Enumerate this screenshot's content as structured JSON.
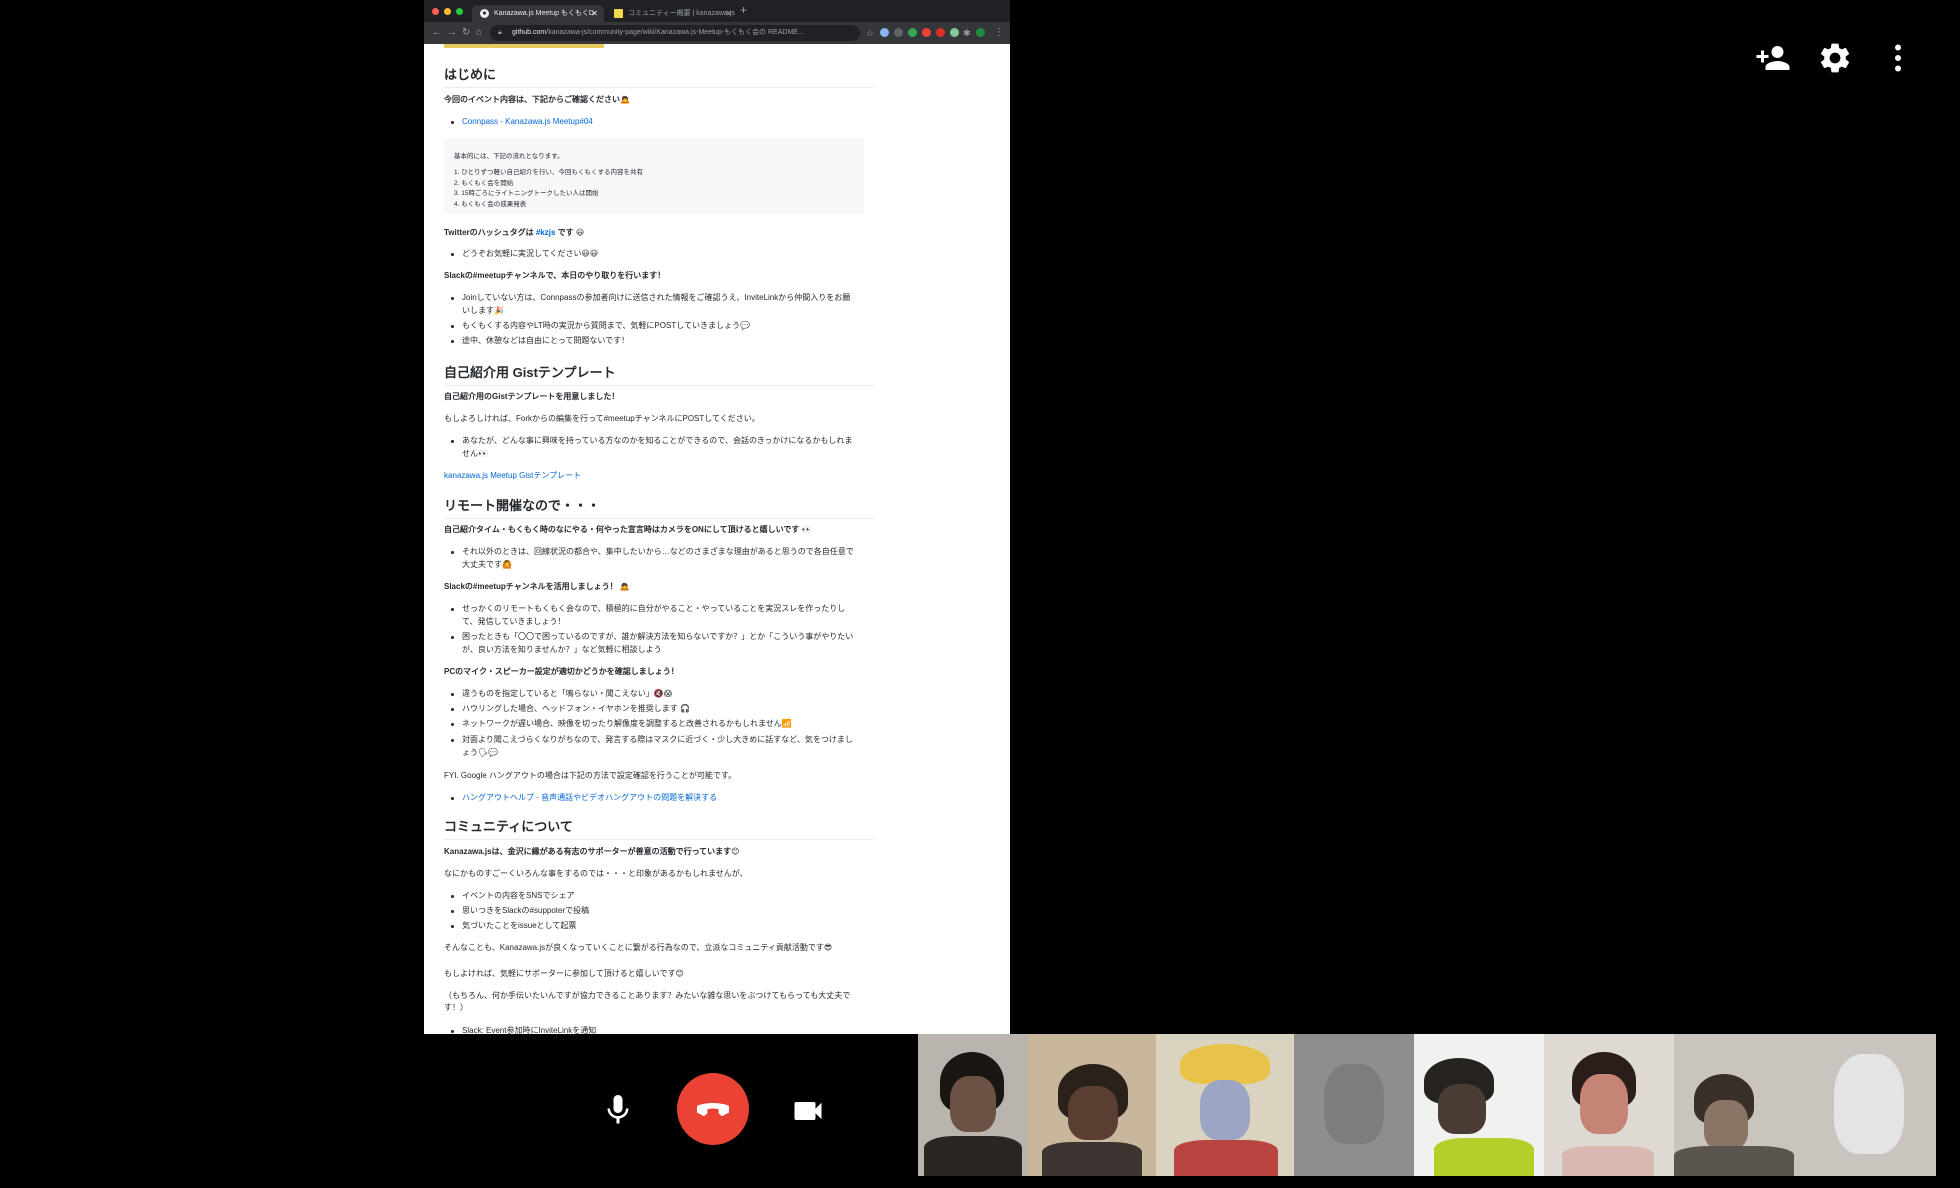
{
  "browser": {
    "tabs": [
      {
        "label": "Kanazawa.js Meetup もくもくD",
        "active": true
      },
      {
        "label": "コミュニティー概要 | kanazawa.js",
        "active": false
      }
    ],
    "url_host": "github.com",
    "url_path": "/kanazawa-js/community-page/wiki/Kanazawa.js-Meetup-もくもく会の README..."
  },
  "doc": {
    "h_intro": "はじめに",
    "intro_text": "今回のイベント内容は、下記からご確認ください🙇",
    "connpass_link": "Connpass - Kanazawa.js Meetup#04",
    "flow_title": "基本的には、下記の流れとなります。",
    "flow_steps": [
      "1. ひとりずつ軽い自己紹介を行い、今回もくもくする内容を共有",
      "2. もくもく会を開始",
      "3. 15時ごろにライトニングトークしたい人は開始",
      "4. もくもく会の成果発表"
    ],
    "twitter_pre": "Twitterのハッシュタグは ",
    "twitter_tag": "#kzjs",
    "twitter_post": " です 😃",
    "twitter_item": "どうぞお気軽に実況してください😃😃",
    "slack_heading": "Slackの#meetupチャンネルで、本日のやり取りを行います！",
    "slack_items": [
      "Joinしていない方は、Connpassの参加者向けに送信された情報をご確認うえ、InviteLinkから仲間入りをお願いします🎉",
      "もくもくする内容やLT時の実況から質問まで、気軽にPOSTしていきましょう💬",
      "途中、休憩などは自由にとって問題ないです！"
    ],
    "h_gist": "自己紹介用 Gistテンプレート",
    "gist_heading": "自己紹介用のGistテンプレートを用意しました！",
    "gist_text": "もしよろしければ、Forkからの編集を行って#meetupチャンネルにPOSTしてください。",
    "gist_item": "あなたが、どんな事に興味を持っている方なのかを知ることができるので、会話のきっかけになるかもしれません👀",
    "gist_link": "kanazawa.js Meetup Gistテンプレート",
    "h_remote": "リモート開催なので・・・",
    "camera_heading": "自己紹介タイム・もくもく時のなにやる・何やった宣言時はカメラをONにして頂けると嬉しいです 👀",
    "camera_item": "それ以外のときは、回線状況の都合や、集中したいから…などのさまざまな理由があると思うので各自任意で大丈夫です🙆",
    "slack2_heading": "Slackの#meetupチャンネルを活用しましょう！ 🙇",
    "slack2_items": [
      "せっかくのリモートもくもく会なので、積極的に自分がやること・やっていることを実況スレを作ったりして、発信していきましょう！",
      "困ったときも「〇〇で困っているのですが、誰か解決方法を知らないですか？」とか「こういう事がやりたいが、良い方法を知りませんか？」など気軽に相談しよう"
    ],
    "pc_heading": "PCのマイク・スピーカー設定が適切かどうかを確認しましょう！",
    "pc_items": [
      "違うものを指定していると「鳴らない・聞こえない」🔇😱",
      "ハウリングした場合、ヘッドフォン・イヤホンを推奨します 🎧",
      "ネットワークが遅い場合、映像を切ったり解像度を調整すると改善されるかもしれません📶",
      "対面より聞こえづらくなりがちなので、発言する際はマスクに近づく・少し大きめに話すなど、気をつけましょう🗣💬"
    ],
    "fyi_text": "FYI. Google ハングアウトの場合は下記の方法で設定確認を行うことが可能です。",
    "fyi_link": "ハングアウトヘルプ - 音声通話やビデオハングアウトの問題を解決する",
    "h_community": "コミュニティについて",
    "community_heading": "Kanazawa.jsは、金沢に縁がある有志のサポーターが善意の活動で行っています😊",
    "community_text": "なにかものすごーくいろんな事をするのでは・・・と印象があるかもしれませんが、",
    "community_items": [
      "イベントの内容をSNSでシェア",
      "思いつきをSlackの#suppoterで投稿",
      "気づいたことをissueとして起票"
    ],
    "closing_1": "そんなことも、Kanazawa.jsが良くなっていくことに繋がる行為なので、立派なコミュニティ貢献活動です😎",
    "closing_2": "もしよければ、気軽にサポーターに参加して頂けると嬉しいです😊",
    "closing_3": "（もちろん、何か手伝いたいんですが協力できることあります？みたいな雑な思いをぶつけてもらっても大丈夫です！）",
    "closing_item": "Slack: Event参加時にInviteLinkを通知"
  },
  "meet": {
    "add_people_icon": "person-add-icon",
    "settings_icon": "gear-icon",
    "more_icon": "more-vert-icon",
    "mic_icon": "microphone-icon",
    "hangup_icon": "phone-hangup-icon",
    "camera_icon": "videocam-icon",
    "hangup_color": "#ea4335",
    "participants": 8
  }
}
